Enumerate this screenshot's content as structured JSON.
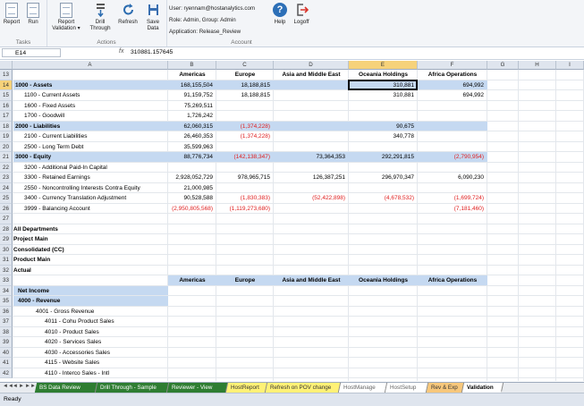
{
  "ribbon": {
    "groups": [
      {
        "label": "Tasks",
        "buttons": [
          "Report",
          "Run"
        ]
      },
      {
        "label": "Actions",
        "buttons": [
          "Report Validation",
          "Drill Through",
          "Refresh",
          "Save Data"
        ]
      },
      {
        "label": "Account"
      }
    ],
    "report_label": "Report",
    "run_label": "Run",
    "validation_label": "Report Validation ▾",
    "drill_label": "Drill Through",
    "refresh_label": "Refresh",
    "save_label": "Save Data",
    "help_label": "Help",
    "logoff_label": "Logoff",
    "tasks_label": "Tasks",
    "actions_label": "Actions",
    "account_label": "Account",
    "user": "User: ryennam@hostanalytics.com",
    "role": "Role: Admin, Group: Admin",
    "application": "Application: Release_Review"
  },
  "formula_bar": {
    "name_box": "E14",
    "fx": "fx",
    "formula": "310881.157645"
  },
  "columns": [
    "A",
    "B",
    "C",
    "D",
    "E",
    "F",
    "G",
    "H",
    "I"
  ],
  "rows": [
    13,
    14,
    15,
    16,
    17,
    18,
    19,
    20,
    21,
    22,
    23,
    24,
    25,
    26,
    27,
    28,
    29,
    30,
    31,
    32,
    33,
    34,
    35,
    36,
    37,
    38,
    39,
    40,
    41,
    42
  ],
  "header1": [
    "Americas",
    "Europe",
    "Asia and Middle East",
    "Oceania Holdings",
    "Africa Operations"
  ],
  "header2": [
    "Americas",
    "Europe",
    "Asia and Middle East",
    "Oceania Holdings",
    "Africa Operations"
  ],
  "data_rows": [
    {
      "label": "1000 - Assets",
      "bold": true,
      "hl": true,
      "vals": [
        "168,155,504",
        "18,188,815",
        "",
        "310,881",
        "694,992"
      ]
    },
    {
      "label": "1100 - Current Assets",
      "indent": 1,
      "vals": [
        "91,159,752",
        "18,188,815",
        "",
        "310,881",
        "694,992"
      ]
    },
    {
      "label": "1600 - Fixed Assets",
      "indent": 1,
      "vals": [
        "75,269,511",
        "",
        "",
        "",
        ""
      ]
    },
    {
      "label": "1700 - Goodwill",
      "indent": 1,
      "vals": [
        "1,726,242",
        "",
        "",
        "",
        ""
      ]
    },
    {
      "label": "2000 - Liabilities",
      "bold": true,
      "hl": true,
      "vals": [
        "62,060,315",
        "(1,374,228)",
        "",
        "90,675",
        ""
      ]
    },
    {
      "label": "2100 - Current Liabilities",
      "indent": 1,
      "vals": [
        "26,460,353",
        "(1,374,228)",
        "",
        "340,778",
        ""
      ]
    },
    {
      "label": "2500 - Long Term Debt",
      "indent": 1,
      "vals": [
        "35,599,963",
        "",
        "",
        "",
        ""
      ]
    },
    {
      "label": "3000 - Equity",
      "bold": true,
      "hl": true,
      "vals": [
        "88,776,734",
        "(142,138,347)",
        "73,364,353",
        "292,291,815",
        "(2,790,954)"
      ]
    },
    {
      "label": "3200 - Additional Paid-In Capital",
      "indent": 1,
      "vals": [
        "",
        "",
        "",
        "",
        ""
      ]
    },
    {
      "label": "3300 - Retained Earnings",
      "indent": 1,
      "vals": [
        "2,928,052,729",
        "978,965,715",
        "126,387,251",
        "296,970,347",
        "6,090,230"
      ]
    },
    {
      "label": "2550 - Noncontrolling Interests Contra Equity",
      "indent": 1,
      "vals": [
        "21,000,985",
        "",
        "",
        "",
        ""
      ]
    },
    {
      "label": "3400 - Currency Translation Adjustment",
      "indent": 1,
      "vals": [
        "90,528,588",
        "(1,830,383)",
        "(52,422,898)",
        "(4,678,532)",
        "(1,699,724)"
      ]
    },
    {
      "label": "3999 - Balancing Account",
      "indent": 1,
      "vals": [
        "(2,950,805,568)",
        "(1,119,273,680)",
        "",
        "",
        "(7,181,460)"
      ]
    }
  ],
  "pov": [
    "All Departments",
    "Project Main",
    "Consolidated (CC)",
    "Product Main",
    "Actual"
  ],
  "income_rows": [
    {
      "label": "Net Income",
      "bold": true,
      "hl": true,
      "indent": 0
    },
    {
      "label": "4000 - Revenue",
      "bold": true,
      "hl": true,
      "indent": 0
    },
    {
      "label": "4001 - Gross Revenue",
      "indent": 2
    },
    {
      "label": "4011 - Cohu Product Sales",
      "indent": 3
    },
    {
      "label": "4010 - Product Sales",
      "indent": 3
    },
    {
      "label": "4020 - Services Sales",
      "indent": 3
    },
    {
      "label": "4030 - Accessories Sales",
      "indent": 3
    },
    {
      "label": "4115 - Website Sales",
      "indent": 3
    },
    {
      "label": "4110 - Interco Sales - Intl",
      "indent": 3
    }
  ],
  "sheet_tabs": [
    "BS Data Review",
    "Drill Through - Sample",
    "Reviewer - View",
    "HostReport",
    "Refresh on POV change",
    "HostManage",
    "HostSetup",
    "Rev & Exp",
    "Validation"
  ],
  "status": "Ready",
  "colors": {
    "highlight": "#c5d9f1",
    "negative": "#e02020",
    "selected_header": "#f6d27a"
  }
}
